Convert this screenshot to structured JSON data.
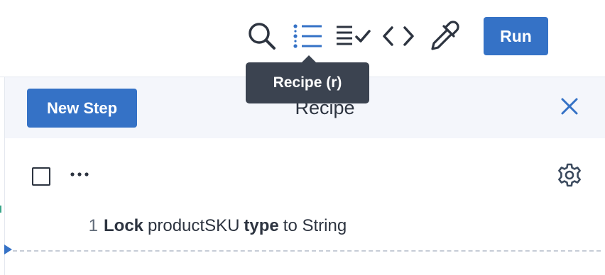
{
  "toolbar": {
    "icons": [
      {
        "name": "search-icon"
      },
      {
        "name": "recipe-list-icon",
        "active": true
      },
      {
        "name": "checklist-icon"
      },
      {
        "name": "code-icon"
      },
      {
        "name": "eyedropper-icon"
      }
    ],
    "run_label": "Run"
  },
  "tooltip": {
    "text": "Recipe (r)"
  },
  "recipe_panel": {
    "title": "Recipe",
    "new_step_label": "New Step",
    "more_label": "⋯",
    "steps": [
      {
        "number": "1",
        "parts": [
          "Lock",
          "productSKU",
          "type",
          "to String"
        ]
      }
    ]
  },
  "colors": {
    "accent": "#3572c6",
    "tooltip_bg": "#3b4350",
    "header_bg": "#f4f6fb",
    "text": "#2d3440"
  }
}
